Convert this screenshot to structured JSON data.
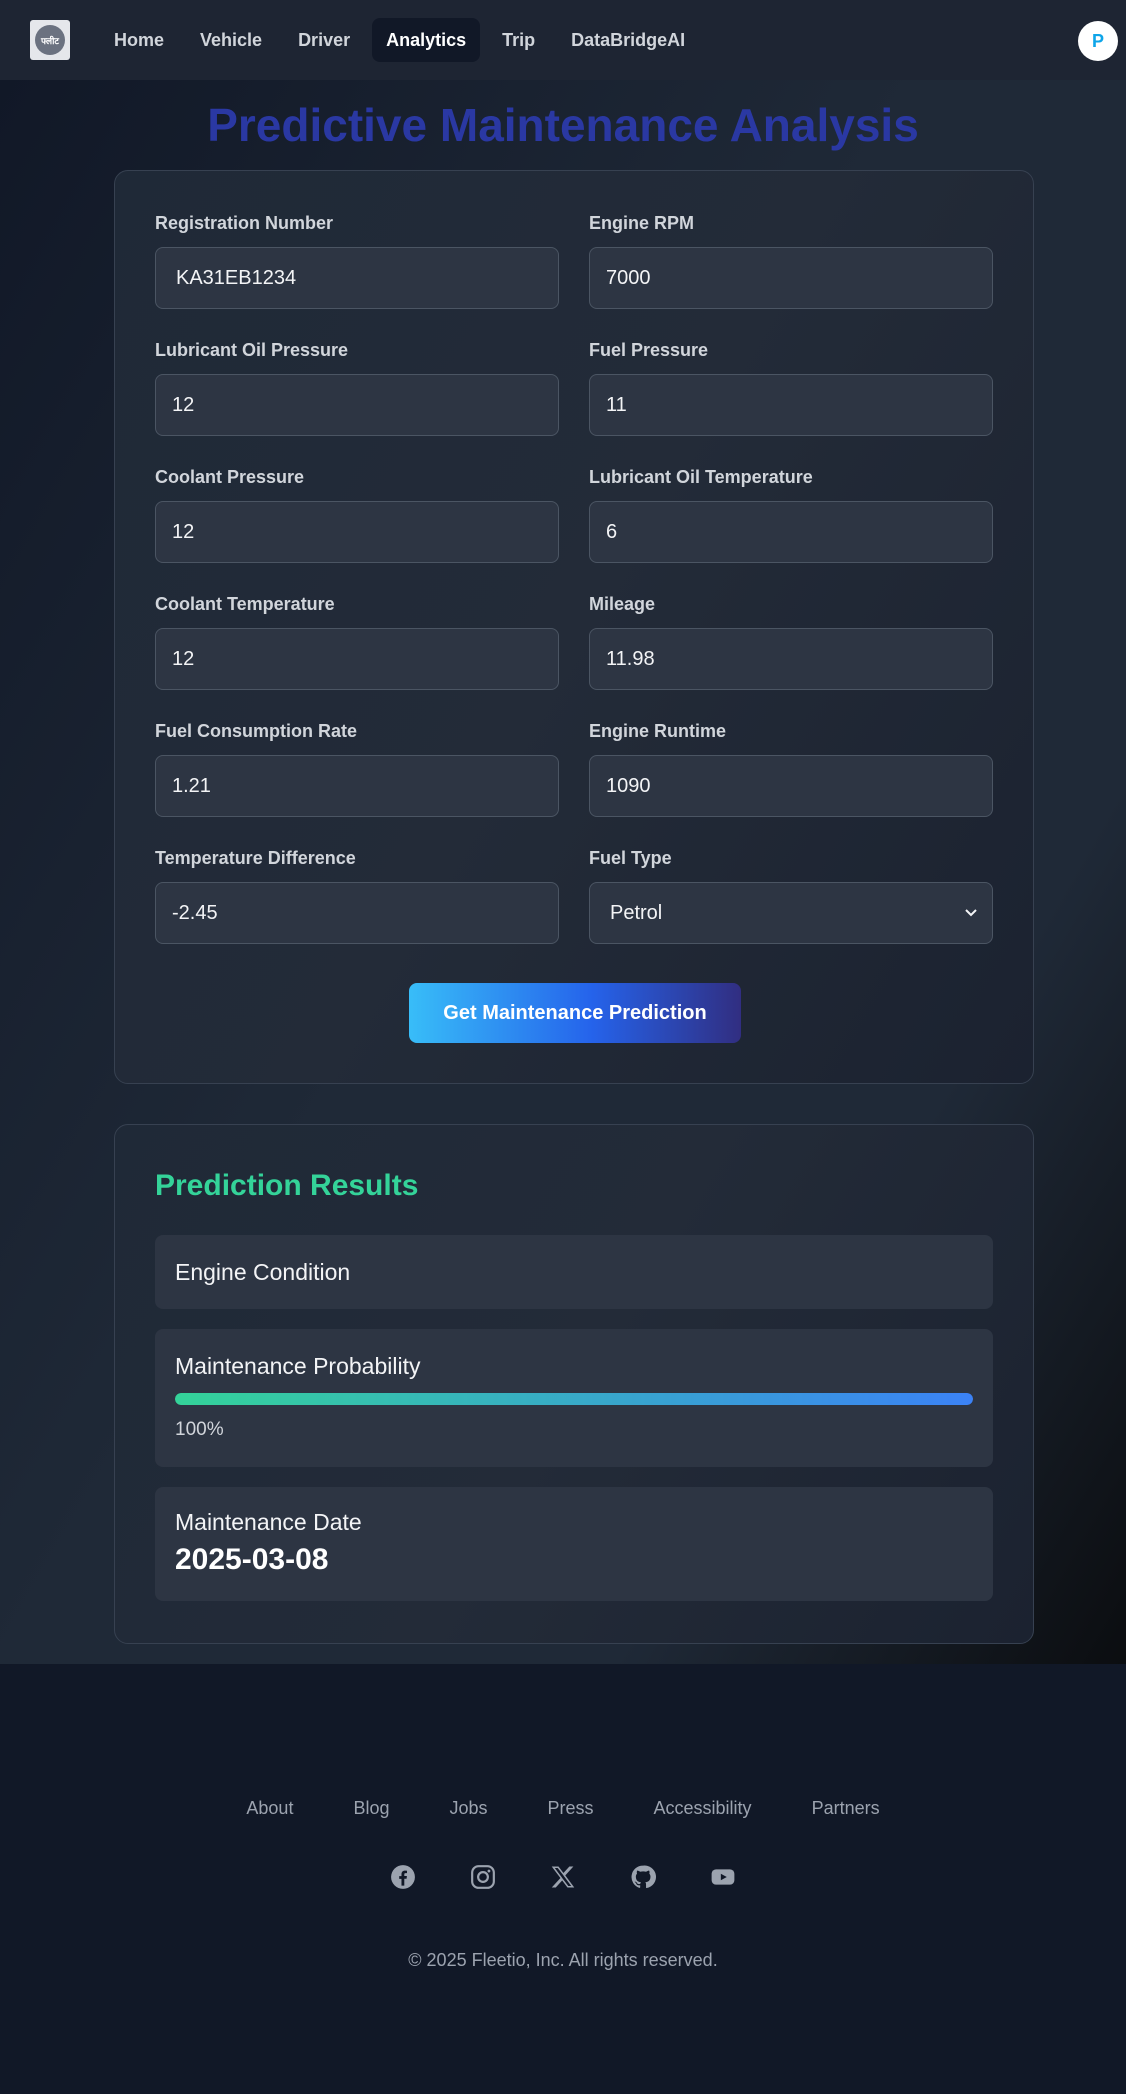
{
  "nav": {
    "logo_text": "फ्लीट",
    "links": [
      "Home",
      "Vehicle",
      "Driver",
      "Analytics",
      "Trip",
      "DataBridgeAI"
    ],
    "active": "Analytics",
    "avatar_letter": "P"
  },
  "page_title": "Predictive Maintenance Analysis",
  "form": {
    "fields": [
      {
        "label": "Registration Number",
        "value": "KA31EB1234"
      },
      {
        "label": "Engine RPM",
        "value": "7000"
      },
      {
        "label": "Lubricant Oil Pressure",
        "value": "12"
      },
      {
        "label": "Fuel Pressure",
        "value": "11"
      },
      {
        "label": "Coolant Pressure",
        "value": "12"
      },
      {
        "label": "Lubricant Oil Temperature",
        "value": "6"
      },
      {
        "label": "Coolant Temperature",
        "value": "12"
      },
      {
        "label": "Mileage",
        "value": "11.98"
      },
      {
        "label": "Fuel Consumption Rate",
        "value": "1.21"
      },
      {
        "label": "Engine Runtime",
        "value": "1090"
      },
      {
        "label": "Temperature Difference",
        "value": "-2.45"
      },
      {
        "label": "Fuel Type",
        "value": "Petrol"
      }
    ],
    "submit_label": "Get Maintenance Prediction"
  },
  "results": {
    "title": "Prediction Results",
    "engine_condition_label": "Engine Condition",
    "probability_label": "Maintenance Probability",
    "probability_value": "100%",
    "probability_fraction": 1.0,
    "date_label": "Maintenance Date",
    "date_value": "2025-03-08"
  },
  "footer": {
    "links": [
      "About",
      "Blog",
      "Jobs",
      "Press",
      "Accessibility",
      "Partners"
    ],
    "social_icons": [
      "facebook-icon",
      "instagram-icon",
      "x-icon",
      "github-icon",
      "youtube-icon"
    ],
    "copyright": "© 2025 Fleetio, Inc. All rights reserved."
  },
  "colors": {
    "accent_title": "#2a38a3",
    "results_title": "#34d399",
    "button_gradient_start": "#38bdf8",
    "button_gradient_end": "#312e81"
  }
}
